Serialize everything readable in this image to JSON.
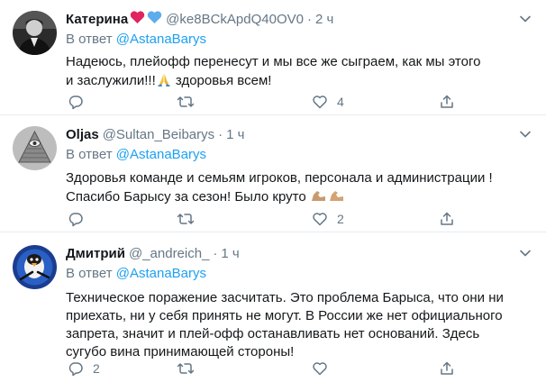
{
  "tweets": [
    {
      "name": "Катерина",
      "handle": "@ke8BCkApdQ40OV0",
      "dot": "·",
      "time": "2 ч",
      "reply_prefix": "В ответ",
      "reply_to": "@AstanaBarys",
      "text_line1": "Надеюсь, плейофф перенесут и мы все же сыграем, как мы этого",
      "text_line2_a": "и заслужили!!!",
      "text_line2_b": " здоровья всем!",
      "replies": "",
      "retweets": "",
      "likes": "4"
    },
    {
      "name": "Oljas",
      "handle": "@Sultan_Beibarys",
      "dot": "·",
      "time": "1 ч",
      "reply_prefix": "В ответ",
      "reply_to": "@AstanaBarys",
      "text_line1": "Здоровья команде и семьям игроков, персонала и администрации !",
      "text_line2": "Спасибо Барысу за сезон! Было круто",
      "replies": "",
      "retweets": "",
      "likes": "2"
    },
    {
      "name": "Дмитрий",
      "handle": "@_andreich_",
      "dot": "·",
      "time": "1 ч",
      "reply_prefix": "В ответ",
      "reply_to": "@AstanaBarys",
      "text_line1": "Техническое поражение засчитать. Это проблема Барыса, что они ни",
      "text_line2": "приехать, ни у себя принять не могут. В России же нет официального",
      "text_line3": "запрета, значит и плей-офф останавливать нет оснований. Здесь",
      "text_line4": "сугубо вина принимающей стороны!",
      "replies": "2",
      "retweets": "",
      "likes": ""
    }
  ],
  "colors": {
    "accent": "#1da1f2",
    "secondary_text": "#657786",
    "primary_text": "#14171a",
    "divider": "#e6ecf0",
    "heart_red": "#e0245e",
    "heart_blue": "#5dadec"
  },
  "icons": [
    "reply-icon",
    "retweet-icon",
    "like-icon",
    "share-icon",
    "chevron-down-icon",
    "red-heart-emoji",
    "blue-heart-emoji",
    "folded-hands-emoji",
    "flexed-biceps-emoji"
  ]
}
